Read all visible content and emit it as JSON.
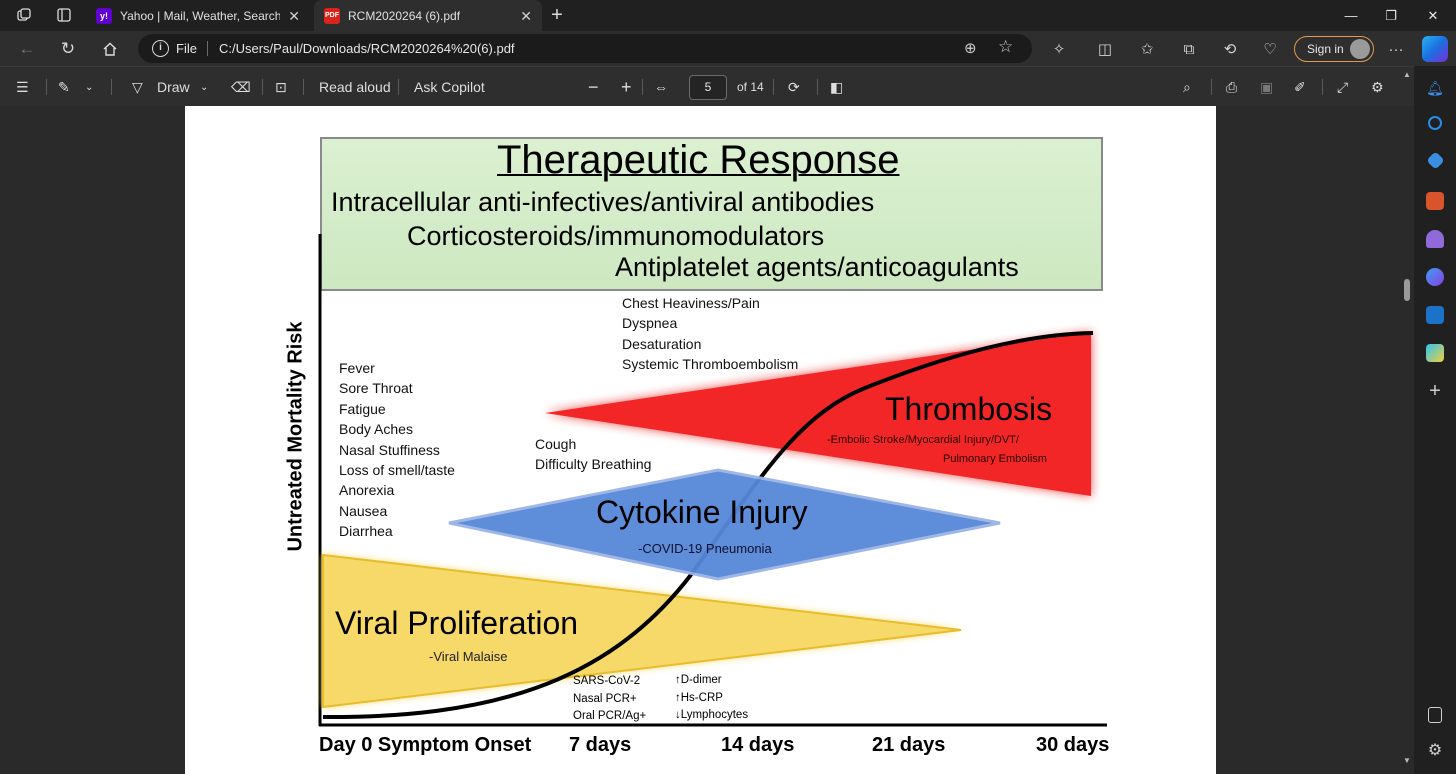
{
  "tabs": [
    {
      "title": "Yahoo | Mail, Weather, Search, N",
      "favicon": "yahoo-favicon",
      "active": false
    },
    {
      "title": "RCM2020264 (6).pdf",
      "favicon": "pdf-favicon",
      "active": true
    }
  ],
  "address": {
    "scheme_label": "File",
    "url": "C:/Users/Paul/Downloads/RCM2020264%20(6).pdf"
  },
  "profile": {
    "signin_label": "Sign in"
  },
  "pdf_toolbar": {
    "draw_label": "Draw",
    "read_aloud_label": "Read aloud",
    "ask_copilot_label": "Ask Copilot",
    "page_number": "5",
    "page_total": "of 14"
  },
  "figure": {
    "header": {
      "title": "Therapeutic Response",
      "line1": "Intracellular anti-infectives/antiviral antibodies",
      "line2": "Corticosteroids/immunomodulators",
      "line3": "Antiplatelet agents/anticoagulants"
    },
    "y_axis_label": "Untreated Mortality Risk",
    "x_ticks": [
      "Day 0 Symptom Onset",
      "7 days",
      "14 days",
      "21 days",
      "30 days"
    ],
    "early_symptoms": [
      "Fever",
      "Sore Throat",
      "Fatigue",
      "Body Aches",
      "Nasal Stuffiness",
      "Loss of smell/taste",
      "Anorexia",
      "Nausea",
      "Diarrhea"
    ],
    "mid_symptoms": [
      "Cough",
      "Difficulty Breathing"
    ],
    "late_symptoms": [
      "Chest Heaviness/Pain",
      "Dyspnea",
      "Desaturation",
      "Systemic Thromboembolism"
    ],
    "phases": {
      "viral": {
        "title": "Viral Proliferation",
        "subtitle": "-Viral Malaise",
        "color": "#f5d04a"
      },
      "cytokine": {
        "title": "Cytokine Injury",
        "subtitle": "-COVID-19 Pneumonia",
        "color": "#4f7fd3"
      },
      "thrombosis": {
        "title": "Thrombosis",
        "subtitle1": "-Embolic Stroke/Myocardial Injury/DVT/",
        "subtitle2": "Pulmonary Embolism",
        "color": "#ec2424"
      }
    },
    "tests_left": [
      "SARS-CoV-2",
      "Nasal PCR+",
      "Oral PCR/Ag+"
    ],
    "tests_right": [
      "↑D-dimer",
      "↑Hs-CRP",
      "↓Lymphocytes"
    ],
    "header_bg": "#d2ecc6"
  }
}
